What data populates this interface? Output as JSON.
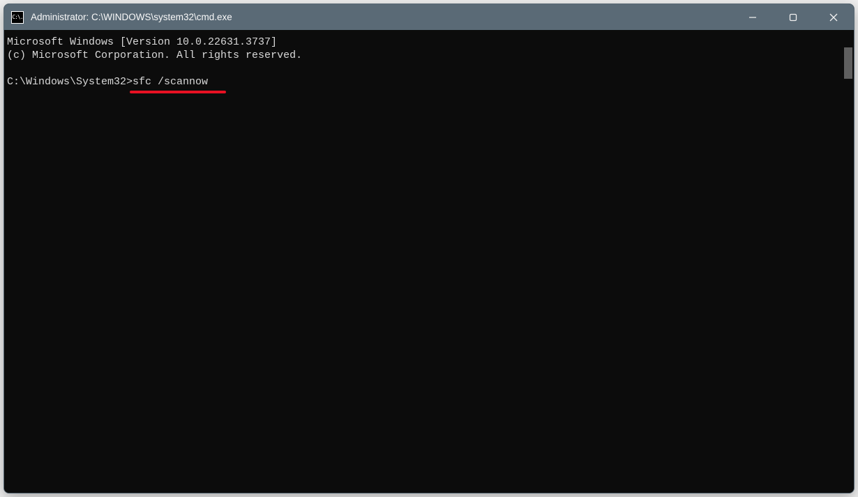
{
  "titlebar": {
    "icon_label": "C:\\.",
    "title": "Administrator: C:\\WINDOWS\\system32\\cmd.exe"
  },
  "controls": {
    "minimize": "minimize",
    "maximize": "maximize",
    "close": "close"
  },
  "terminal": {
    "line1": "Microsoft Windows [Version 10.0.22631.3737]",
    "line2": "(c) Microsoft Corporation. All rights reserved.",
    "blank": "",
    "prompt": "C:\\Windows\\System32>",
    "command": "sfc /scannow"
  },
  "annotation": {
    "underline_color": "#e81123"
  }
}
